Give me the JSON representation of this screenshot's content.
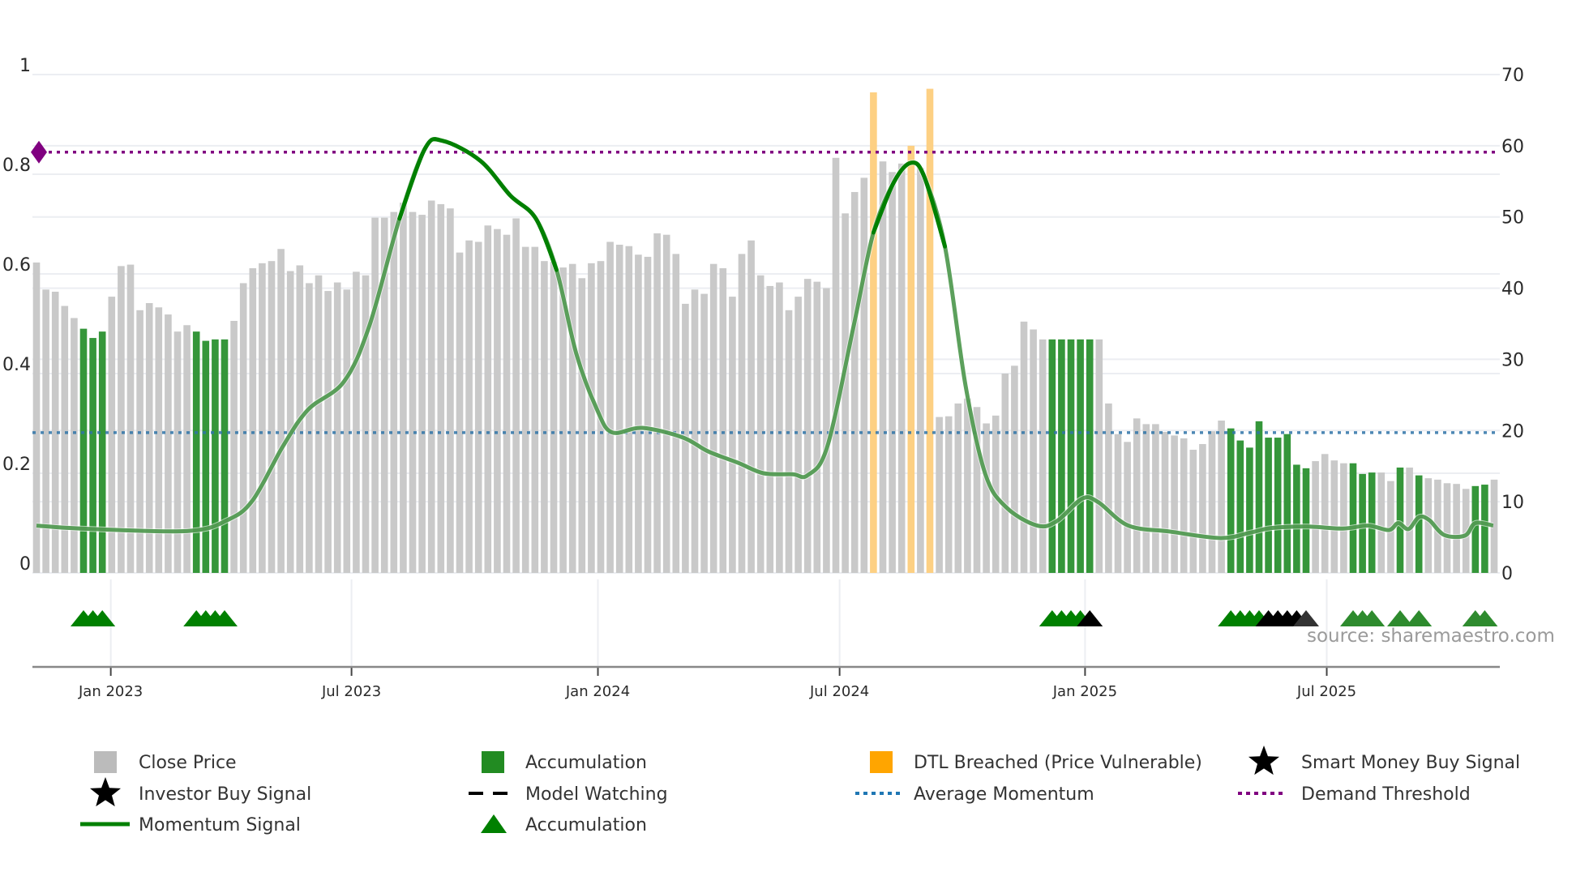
{
  "chart_data": {
    "type": "bar",
    "title": "",
    "xlabel": "",
    "ylabel_left": "",
    "ylabel_right": "",
    "ylim_left": [
      0,
      1
    ],
    "ylim_right": [
      0,
      70
    ],
    "grid": true,
    "legend_position": "bottom",
    "left_ticks": [
      "0",
      "0.2",
      "0.4",
      "0.6",
      "0.8",
      "1"
    ],
    "right_ticks": [
      "0",
      "10",
      "20",
      "30",
      "40",
      "50",
      "60",
      "70"
    ],
    "x_ticks": [
      {
        "label": "Jan 2023",
        "week": 7.9
      },
      {
        "label": "Jul 2023",
        "week": 33.5
      },
      {
        "label": "Jan 2024",
        "week": 59.7
      },
      {
        "label": "Jul 2024",
        "week": 85.4
      },
      {
        "label": "Jan 2025",
        "week": 111.5
      },
      {
        "label": "Jul 2025",
        "week": 137.2
      }
    ],
    "close_price": [
      43.6,
      39.8,
      39.5,
      37.5,
      35.8,
      34.3,
      33.0,
      33.9,
      38.8,
      43.1,
      43.3,
      36.9,
      37.9,
      37.3,
      36.3,
      33.9,
      34.8,
      33.9,
      32.6,
      32.8,
      32.8,
      35.4,
      40.7,
      42.8,
      43.5,
      43.8,
      45.5,
      42.4,
      43.2,
      40.7,
      41.8,
      39.6,
      40.8,
      39.8,
      42.3,
      41.8,
      49.9,
      49.9,
      50.7,
      52.0,
      50.7,
      50.3,
      52.3,
      51.8,
      51.2,
      45.0,
      46.7,
      46.5,
      48.8,
      48.3,
      47.5,
      49.8,
      45.8,
      45.8,
      43.8,
      43.7,
      42.9,
      43.4,
      41.4,
      43.5,
      43.8,
      46.5,
      46.1,
      45.9,
      44.7,
      44.4,
      47.7,
      47.5,
      44.8,
      37.8,
      39.8,
      39.2,
      43.4,
      42.8,
      38.8,
      44.8,
      46.7,
      41.8,
      40.3,
      40.8,
      36.9,
      38.8,
      41.3,
      40.9,
      40.0,
      58.3,
      50.5,
      53.5,
      55.5,
      67.5,
      57.8,
      56.3,
      57.5,
      60.0,
      56.9,
      68.0,
      21.9,
      22.0,
      23.8,
      24.5,
      23.3,
      21.0,
      22.1,
      28.0,
      29.1,
      35.3,
      34.2,
      32.8,
      32.8,
      32.8,
      32.8,
      32.8,
      32.8,
      32.8,
      23.8,
      19.5,
      18.4,
      21.7,
      20.9,
      20.9,
      19.8,
      19.3,
      18.9,
      17.3,
      18.1,
      19.9,
      21.4,
      20.3,
      18.6,
      17.6,
      21.3,
      19.0,
      19.0,
      19.5,
      15.2,
      14.7,
      15.7,
      16.7,
      15.8,
      15.4,
      15.4,
      13.9,
      14.1,
      14.1,
      12.9,
      14.8,
      14.8,
      13.7,
      13.3,
      13.1,
      12.6,
      12.5,
      11.8,
      12.2,
      12.4,
      13.1
    ],
    "accumulation_weeks": [
      5,
      6,
      7,
      17,
      18,
      19,
      20,
      108,
      109,
      110,
      111,
      112,
      127,
      128,
      129,
      130,
      131,
      132,
      133,
      134,
      135,
      140,
      141,
      142,
      145,
      147,
      153,
      154
    ],
    "dtl_breached_weeks": [
      89,
      93,
      95
    ],
    "momentum_signal": [
      [
        0,
        0.095
      ],
      [
        4.7,
        0.089
      ],
      [
        16.0,
        0.084
      ],
      [
        20.3,
        0.106
      ],
      [
        23.0,
        0.146
      ],
      [
        26.2,
        0.254
      ],
      [
        28.9,
        0.328
      ],
      [
        32.7,
        0.384
      ],
      [
        35.4,
        0.496
      ],
      [
        38.6,
        0.711
      ],
      [
        41.3,
        0.851
      ],
      [
        43.2,
        0.867
      ],
      [
        47.2,
        0.827
      ],
      [
        50.4,
        0.757
      ],
      [
        53.1,
        0.711
      ],
      [
        55.3,
        0.608
      ],
      [
        57.4,
        0.44
      ],
      [
        59.6,
        0.328
      ],
      [
        61.2,
        0.282
      ],
      [
        64.4,
        0.291
      ],
      [
        68.7,
        0.272
      ],
      [
        71.4,
        0.244
      ],
      [
        74.6,
        0.221
      ],
      [
        77.3,
        0.2
      ],
      [
        80.4,
        0.198
      ],
      [
        82.0,
        0.196
      ],
      [
        84.1,
        0.254
      ],
      [
        86.9,
        0.496
      ],
      [
        89.0,
        0.683
      ],
      [
        91.2,
        0.785
      ],
      [
        93.0,
        0.823
      ],
      [
        94.4,
        0.795
      ],
      [
        96.6,
        0.655
      ],
      [
        98.8,
        0.375
      ],
      [
        100.9,
        0.198
      ],
      [
        103.1,
        0.132
      ],
      [
        106.4,
        0.095
      ],
      [
        108.5,
        0.104
      ],
      [
        111.2,
        0.149
      ],
      [
        112.9,
        0.142
      ],
      [
        116.1,
        0.095
      ],
      [
        120.5,
        0.083
      ],
      [
        125.9,
        0.07
      ],
      [
        129.1,
        0.081
      ],
      [
        131.3,
        0.09
      ],
      [
        135.1,
        0.093
      ],
      [
        138.9,
        0.089
      ],
      [
        141.6,
        0.095
      ],
      [
        143.8,
        0.086
      ],
      [
        144.8,
        0.1
      ],
      [
        145.9,
        0.088
      ],
      [
        147.0,
        0.112
      ],
      [
        148.1,
        0.106
      ],
      [
        149.7,
        0.076
      ],
      [
        151.9,
        0.075
      ],
      [
        153.0,
        0.1
      ],
      [
        154.9,
        0.095
      ]
    ],
    "average_momentum": 19.7,
    "demand_threshold": 59.1,
    "accumulation_markers": [
      5,
      6,
      7,
      17,
      18,
      19,
      20,
      108,
      109,
      110,
      111,
      127,
      128,
      129,
      130,
      140,
      141,
      142,
      145,
      147,
      153,
      154
    ],
    "investor_buy_markers": [
      112,
      131,
      132,
      133,
      134
    ],
    "model_watching_markers": [
      135
    ],
    "legend": [
      {
        "label": "Close Price",
        "symbol": "square",
        "color": "#bbbbbb"
      },
      {
        "label": "Accumulation",
        "symbol": "square",
        "color": "#228b22"
      },
      {
        "label": "DTL Breached (Price Vulnerable)",
        "symbol": "square",
        "color": "#ffa500"
      },
      {
        "label": "Smart Money Buy Signal",
        "symbol": "star",
        "color": "#0000ff"
      },
      {
        "label": "Investor Buy Signal",
        "symbol": "star",
        "color": "#000000"
      },
      {
        "label": "Model Watching",
        "symbol": "dash",
        "color": "#000000"
      },
      {
        "label": "Average Momentum",
        "symbol": "dot",
        "color": "#1f77b4"
      },
      {
        "label": "Demand Threshold",
        "symbol": "dot",
        "color": "#800080"
      },
      {
        "label": "Momentum Signal",
        "symbol": "line",
        "color": "#008000"
      },
      {
        "label": "Accumulation",
        "symbol": "triangle",
        "color": "#008000"
      }
    ],
    "source": "source: sharemaestro.com"
  }
}
